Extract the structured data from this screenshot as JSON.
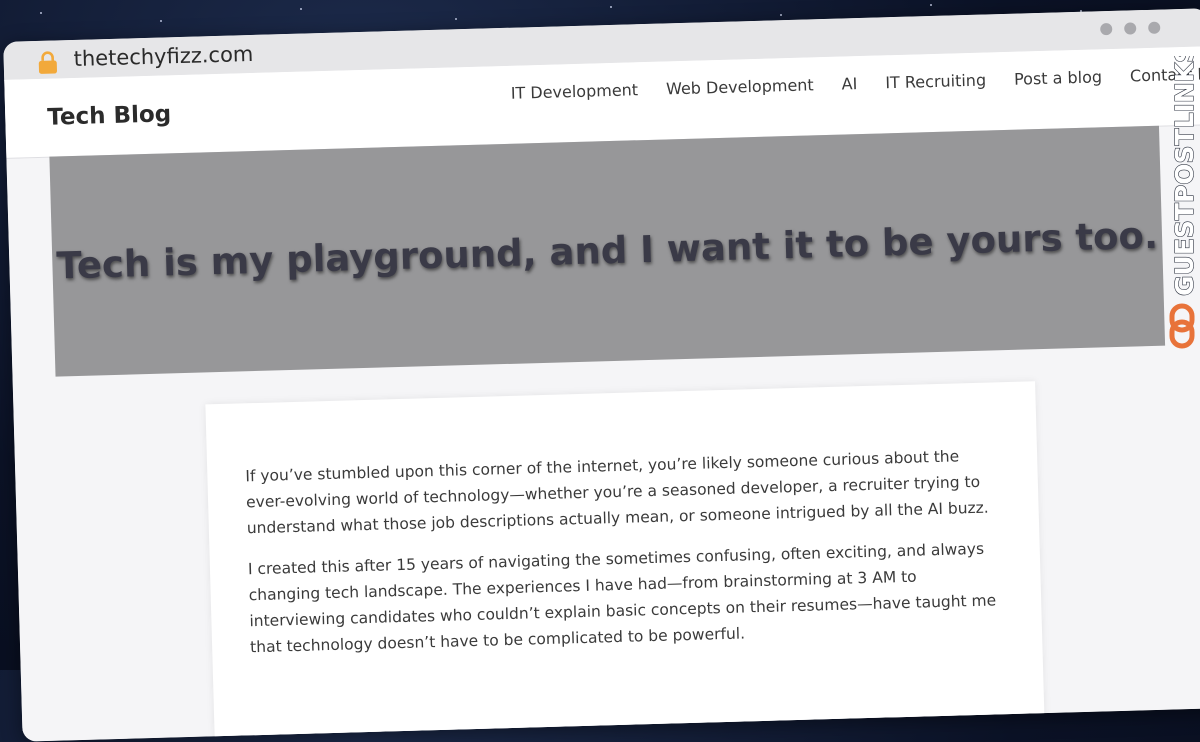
{
  "browser": {
    "url": "thetechyfizz.com"
  },
  "site": {
    "brand": "Tech Blog",
    "nav": [
      {
        "label": "IT Development"
      },
      {
        "label": "Web Development"
      },
      {
        "label": "AI"
      },
      {
        "label": "IT Recruiting"
      },
      {
        "label": "Post a blog"
      },
      {
        "label": "Contact Me"
      }
    ]
  },
  "hero": {
    "title": "Tech is my playground, and I want it to be yours too."
  },
  "content": {
    "paragraphs": [
      "If you’ve stumbled upon this corner of the internet, you’re likely someone curious about the ever-evolving world of technology—whether you’re a seasoned developer, a recruiter trying to understand what those job descriptions actually mean, or someone intrigued by all the AI buzz.",
      "I created this after 15 years of navigating the sometimes confusing, often exciting, and always changing tech landscape. The experiences I have had—from brainstorming at 3 AM to interviewing candidates who couldn’t explain basic concepts on their resumes—have taught me that technology doesn’t have to be complicated to be powerful."
    ]
  },
  "watermark": {
    "text": "GUESTPOSTLINKS"
  },
  "colors": {
    "background": "#0b1226",
    "hero": "#979799",
    "lock": "#f2a93b",
    "watermark_accent": "#e8733a"
  }
}
